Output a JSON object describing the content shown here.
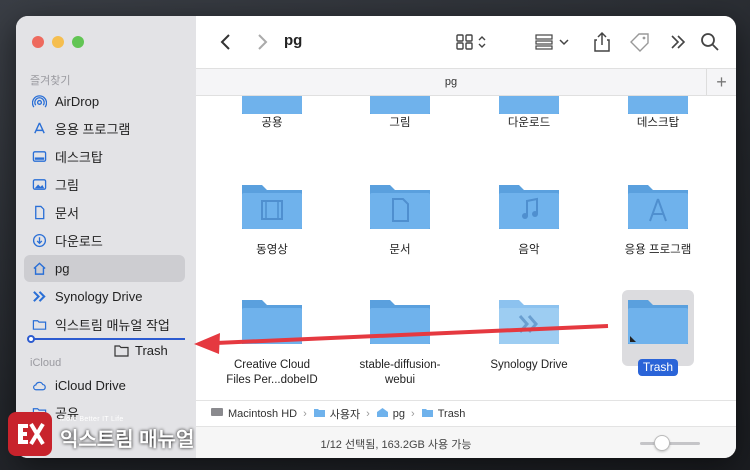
{
  "sidebar": {
    "favorites_header": "즐겨찾기",
    "icloud_header": "iCloud",
    "items": [
      {
        "label": "AirDrop",
        "icon": "airdrop-icon"
      },
      {
        "label": "응용 프로그램",
        "icon": "applications-icon"
      },
      {
        "label": "데스크탑",
        "icon": "desktop-icon"
      },
      {
        "label": "그림",
        "icon": "pictures-icon"
      },
      {
        "label": "문서",
        "icon": "document-icon"
      },
      {
        "label": "다운로드",
        "icon": "downloads-icon"
      },
      {
        "label": "pg",
        "icon": "home-icon"
      },
      {
        "label": "Synology Drive",
        "icon": "synology-icon"
      },
      {
        "label": "익스트림 매뉴얼 작업",
        "icon": "folder-icon"
      }
    ],
    "icloud_items": [
      {
        "label": "iCloud Drive",
        "icon": "cloud-icon"
      },
      {
        "label": "공유",
        "icon": "shared-folder-icon"
      }
    ],
    "drag_label": "Trash"
  },
  "toolbar": {
    "title": "pg"
  },
  "tabbar": {
    "tab_label": "pg",
    "add_label": "+"
  },
  "grid": {
    "row0": [
      "공용",
      "그림",
      "다운로드",
      "데스크탑"
    ],
    "row1": [
      "동영상",
      "문서",
      "음악",
      "응용 프로그램"
    ],
    "row2_label0_line1": "Creative Cloud",
    "row2_label0_line2": "Files Per...dobeID",
    "row2_label1_line1": "stable-diffusion-",
    "row2_label1_line2": "webui",
    "row2_label2": "Synology Drive",
    "row2_label3": "Trash"
  },
  "pathbar": {
    "segments": [
      "Macintosh HD",
      "사용자",
      "pg",
      "Trash"
    ]
  },
  "status": {
    "text": "1/12 선택됨, 163.2GB 사용 가능"
  },
  "watermark": {
    "small": "More Better IT Life",
    "big": "익스트림 매뉴얼"
  },
  "colors": {
    "folder": "#6fb2ec",
    "folder_dark": "#5aa0de",
    "selection": "#2a64d8",
    "arrow": "#e53940"
  }
}
